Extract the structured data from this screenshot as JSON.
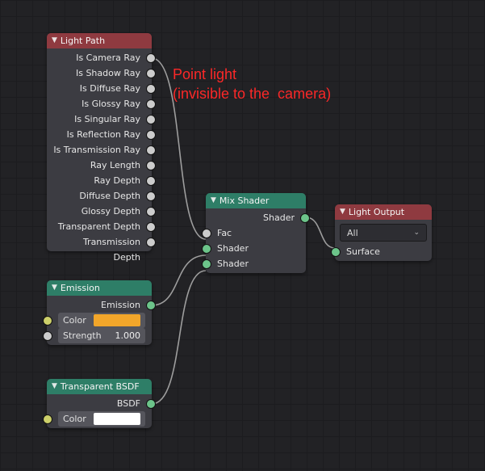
{
  "annotation": "Point light\n(invisible to the  camera)",
  "nodes": {
    "light_path": {
      "title": "Light Path",
      "outputs": [
        "Is Camera Ray",
        "Is Shadow Ray",
        "Is Diffuse Ray",
        "Is Glossy Ray",
        "Is Singular Ray",
        "Is Reflection Ray",
        "Is Transmission Ray",
        "Ray Length",
        "Ray Depth",
        "Diffuse Depth",
        "Glossy Depth",
        "Transparent Depth",
        "Transmission Depth"
      ]
    },
    "emission": {
      "title": "Emission",
      "outputs": [
        "Emission"
      ],
      "color_label": "Color",
      "color_value": "orange",
      "strength_label": "Strength",
      "strength_value": "1.000"
    },
    "transparent": {
      "title": "Transparent BSDF",
      "outputs": [
        "BSDF"
      ],
      "color_label": "Color",
      "color_value": "white"
    },
    "mix": {
      "title": "Mix Shader",
      "outputs": [
        "Shader"
      ],
      "inputs": [
        "Fac",
        "Shader",
        "Shader"
      ]
    },
    "light_output": {
      "title": "Light Output",
      "target_options": [
        "All"
      ],
      "target_selected": "All",
      "inputs": [
        "Surface"
      ]
    }
  },
  "chart_data": {
    "type": "node-graph",
    "nodes": [
      "Light Path",
      "Emission",
      "Transparent BSDF",
      "Mix Shader",
      "Light Output"
    ],
    "edges": [
      {
        "from": "Light Path.Is Camera Ray",
        "to": "Mix Shader.Fac"
      },
      {
        "from": "Emission.Emission",
        "to": "Mix Shader.Shader[0]"
      },
      {
        "from": "Transparent BSDF.BSDF",
        "to": "Mix Shader.Shader[1]"
      },
      {
        "from": "Mix Shader.Shader",
        "to": "Light Output.Surface"
      }
    ]
  }
}
